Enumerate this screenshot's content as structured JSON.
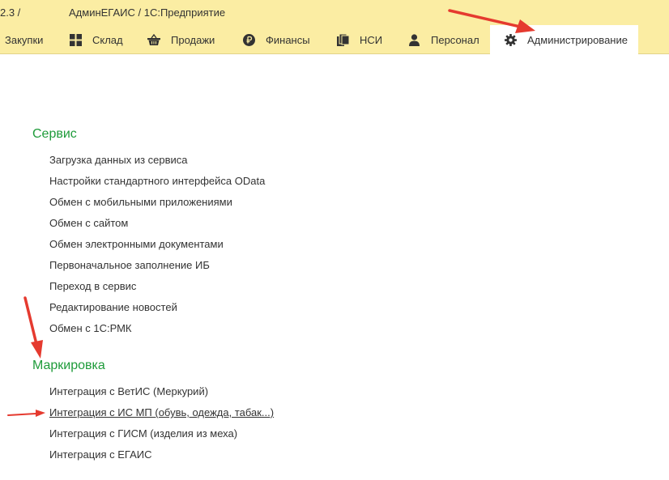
{
  "titlebar": {
    "version": "2.3 /",
    "app_title": "АдминЕГАИС / 1С:Предприятие"
  },
  "menu": {
    "tabs": [
      {
        "label": "Закупки",
        "icon": "none"
      },
      {
        "label": "Склад",
        "icon": "grid-icon"
      },
      {
        "label": "Продажи",
        "icon": "basket-icon"
      },
      {
        "label": "Финансы",
        "icon": "ruble-coin-icon"
      },
      {
        "label": "НСИ",
        "icon": "documents-icon"
      },
      {
        "label": "Персонал",
        "icon": "person-icon"
      },
      {
        "label": "Администрирование",
        "icon": "gear-icon",
        "active": true
      }
    ]
  },
  "sections": {
    "service": {
      "title": "Сервис",
      "items": [
        "Загрузка данных из сервиса",
        "Настройки стандартного интерфейса OData",
        "Обмен с мобильными приложениями",
        "Обмен с сайтом",
        "Обмен электронными документами",
        "Первоначальное заполнение ИБ",
        "Переход в сервис",
        "Редактирование новостей",
        "Обмен с 1С:РМК"
      ]
    },
    "marking": {
      "title": "Маркировка",
      "items": [
        "Интеграция с ВетИС (Меркурий)",
        "Интеграция с ИС МП (обувь, одежда, табак...)",
        "Интеграция с ГИСМ (изделия из меха)",
        "Интеграция с ЕГАИС"
      ]
    }
  },
  "colors": {
    "bar": "#fbeda3",
    "section_title": "#1e9b3a",
    "annotation_arrow": "#e53a2f"
  }
}
